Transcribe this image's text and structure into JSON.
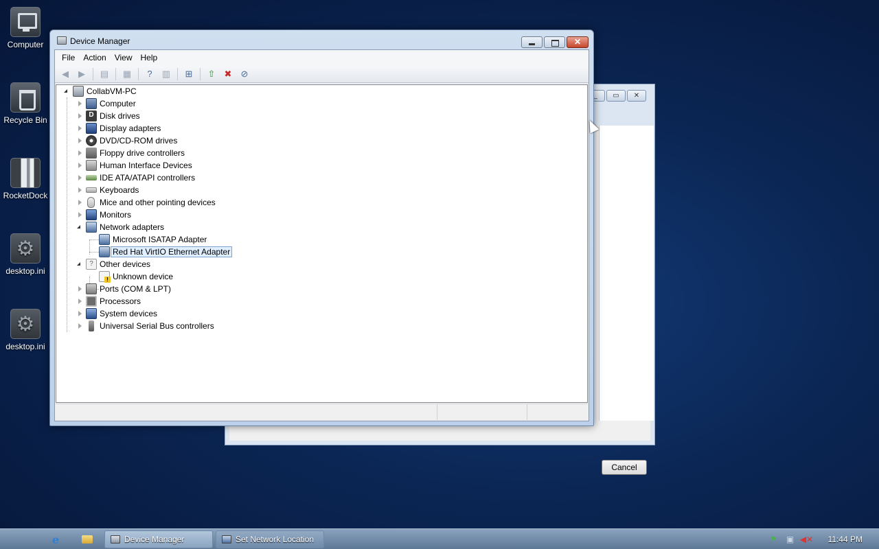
{
  "desktop": {
    "icons": [
      {
        "label": "Computer",
        "icon": "computer-icon"
      },
      {
        "label": "Recycle Bin",
        "icon": "recycle-bin-icon"
      },
      {
        "label": "RocketDock",
        "icon": "rocketdock-icon"
      },
      {
        "label": "desktop.ini",
        "icon": "settings-file-icon"
      },
      {
        "label": "desktop.ini",
        "icon": "settings-file-icon"
      }
    ]
  },
  "background_dialog": {
    "cancel_label": "Cancel"
  },
  "window": {
    "title": "Device Manager",
    "menu": [
      "File",
      "Action",
      "View",
      "Help"
    ],
    "toolbar": [
      "back-icon",
      "forward-icon",
      "show-hide-tree-icon",
      "properties-icon",
      "help-icon",
      "console-tree-icon",
      "scan-hardware-icon",
      "update-driver-icon",
      "uninstall-icon",
      "disable-icon"
    ]
  },
  "tree": {
    "root": "CollabVM-PC",
    "categories": [
      {
        "label": "Computer",
        "icon": "computer-icon"
      },
      {
        "label": "Disk drives",
        "icon": "disk-drive-icon"
      },
      {
        "label": "Display adapters",
        "icon": "display-adapter-icon"
      },
      {
        "label": "DVD/CD-ROM drives",
        "icon": "dvd-icon"
      },
      {
        "label": "Floppy drive controllers",
        "icon": "floppy-controller-icon"
      },
      {
        "label": "Human Interface Devices",
        "icon": "hid-icon"
      },
      {
        "label": "IDE ATA/ATAPI controllers",
        "icon": "ide-controller-icon"
      },
      {
        "label": "Keyboards",
        "icon": "keyboard-icon"
      },
      {
        "label": "Mice and other pointing devices",
        "icon": "mouse-icon"
      },
      {
        "label": "Monitors",
        "icon": "monitor-icon"
      },
      {
        "label": "Network adapters",
        "icon": "network-adapter-icon",
        "expanded": true,
        "children": [
          "Microsoft ISATAP Adapter",
          "Red Hat VirtIO Ethernet Adapter"
        ]
      },
      {
        "label": "Other devices",
        "icon": "other-devices-icon",
        "expanded": true,
        "children": [
          "Unknown device"
        ]
      },
      {
        "label": "Ports (COM & LPT)",
        "icon": "port-icon"
      },
      {
        "label": "Processors",
        "icon": "processor-icon"
      },
      {
        "label": "System devices",
        "icon": "system-device-icon"
      },
      {
        "label": "Universal Serial Bus controllers",
        "icon": "usb-icon"
      }
    ],
    "selected": "Red Hat VirtIO Ethernet Adapter"
  },
  "taskbar": {
    "buttons": [
      "Device Manager",
      "Set Network Location"
    ],
    "clock": "11:44 PM"
  }
}
